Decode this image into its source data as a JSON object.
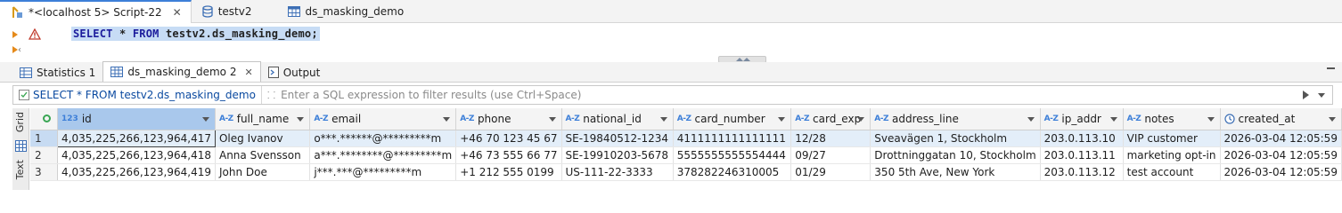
{
  "editor_tabs": [
    {
      "label": "*<localhost 5> Script-22",
      "active": true
    },
    {
      "label": "testv2",
      "active": false
    },
    {
      "label": "ds_masking_demo",
      "active": false
    }
  ],
  "editor": {
    "sql_kw1": "SELECT",
    "sql_mid1": " * ",
    "sql_kw2": "FROM",
    "sql_rest": " testv2.ds_masking_demo;"
  },
  "result_tabs": [
    {
      "label": "Statistics 1",
      "active": false
    },
    {
      "label": "ds_masking_demo 2",
      "active": true
    },
    {
      "label": "Output",
      "active": false
    }
  ],
  "filter": {
    "query_label": "SELECT * FROM testv2.ds_masking_demo",
    "placeholder": "Enter a SQL expression to filter results (use Ctrl+Space)"
  },
  "side_panel": {
    "grid_label": "Grid",
    "text_label": "Text"
  },
  "table": {
    "columns": [
      {
        "type": "123",
        "name": "id"
      },
      {
        "type": "A-Z",
        "name": "full_name"
      },
      {
        "type": "A-Z",
        "name": "email"
      },
      {
        "type": "A-Z",
        "name": "phone"
      },
      {
        "type": "A-Z",
        "name": "national_id"
      },
      {
        "type": "A-Z",
        "name": "card_number"
      },
      {
        "type": "A-Z",
        "name": "card_exp"
      },
      {
        "type": "A-Z",
        "name": "address_line"
      },
      {
        "type": "A-Z",
        "name": "ip_addr"
      },
      {
        "type": "A-Z",
        "name": "notes"
      },
      {
        "type": "clock",
        "name": "created_at"
      }
    ],
    "rows": [
      {
        "n": "1",
        "cells": [
          "4,035,225,266,123,964,417",
          "Oleg Ivanov",
          "o***.******@*********m",
          "+46 70 123 45 67",
          "SE-19840512-1234",
          "4111111111111111",
          "12/28",
          "Sveavägen 1, Stockholm",
          "203.0.113.10",
          "VIP customer",
          "2026-03-04 12:05:59"
        ]
      },
      {
        "n": "2",
        "cells": [
          "4,035,225,266,123,964,418",
          "Anna Svensson",
          "a***.********@*********m",
          "+46 73 555 66 77",
          "SE-19910203-5678",
          "5555555555554444",
          "09/27",
          "Drottninggatan 10, Stockholm",
          "203.0.113.11",
          "marketing opt-in",
          "2026-03-04 12:05:59"
        ]
      },
      {
        "n": "3",
        "cells": [
          "4,035,225,266,123,964,419",
          "John Doe",
          "j***.***@*********m",
          "+1 212 555 0199",
          "US-111-22-3333",
          "378282246310005",
          "01/29",
          "350 5th Ave, New York",
          "203.0.113.12",
          "test account",
          "2026-03-04 12:05:59"
        ]
      }
    ]
  },
  "colors": {
    "accent": "#3d7fd8",
    "selection": "#c7dcf5",
    "warning": "#e58a1a"
  }
}
